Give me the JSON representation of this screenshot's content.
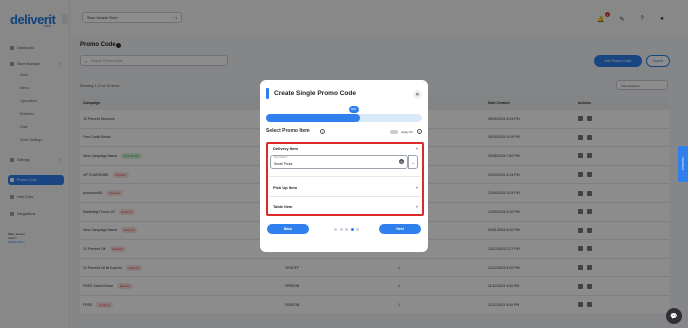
{
  "app": {
    "logo": "deliverit",
    "logo_sub": "WEB"
  },
  "sidebar": {
    "items": [
      {
        "label": "Dashboard"
      },
      {
        "label": "Store Manager"
      },
      {
        "label": "Settings"
      },
      {
        "label": "Promo Code"
      },
      {
        "label": "Help Docs"
      },
      {
        "label": "Integrations"
      }
    ],
    "sub_items": [
      "Store",
      "Menu",
      "Operations",
      "Enablers",
      "Gate",
      "Store Settings"
    ],
    "user": {
      "name": "Mike Jensen",
      "role": "Admin",
      "link": "Switch Store"
    }
  },
  "topbar": {
    "store_select": "Store Sample Store",
    "notification_count": "2"
  },
  "main": {
    "title": "Promo Code",
    "search_placeholder": "Search Promo Code",
    "add_button": "Add Promo Code",
    "export_button": "Export",
    "showing": "Showing 1-10 of 10 items",
    "filter": "View All Items",
    "columns": [
      "Campaign",
      "Code",
      "Usage Count",
      "Date Created",
      "Actions"
    ],
    "rows": [
      {
        "name": "15 Percent Discount",
        "pill": "",
        "code": "",
        "count": "",
        "date": "26/09/2024 4:03 PM"
      },
      {
        "name": "Free Garlic Bread",
        "pill": "",
        "code": "",
        "count": "",
        "date": "26/09/2024 4:03 PM"
      },
      {
        "name": "New Campaign Name",
        "pill": "First Order",
        "pill_type": "first",
        "code": "",
        "count": "",
        "date": "29/08/2024 7:50 PM"
      },
      {
        "name": "UP CHARDNNE",
        "pill": "Expired",
        "pill_type": "exp",
        "code": "",
        "count": "",
        "date": "23/04/2024 4:24 PM"
      },
      {
        "name": "promotion50",
        "pill": "Expired",
        "pill_type": "exp",
        "code": "",
        "count": "",
        "date": "23/04/2024 3:24 PM"
      },
      {
        "name": "Marketing Promo 20",
        "pill": "Expired",
        "pill_type": "exp",
        "code": "",
        "count": "",
        "date": "12/03/2024 4:00 PM"
      },
      {
        "name": "New Campaign Name",
        "pill": "Expired",
        "pill_type": "exp",
        "code": "",
        "count": "",
        "date": "03/01/2024 4:00 PM"
      },
      {
        "name": "10 Percent Off",
        "pill": "Expired",
        "pill_type": "exp",
        "code": "TEN2OFF",
        "count": "1",
        "date": "13/12/2023 2:27 PM"
      },
      {
        "name": "10 Percent off all Experts",
        "pill": "Expired",
        "pill_type": "exp",
        "code": "TENOFF",
        "count": "1",
        "date": "12/12/2023 4:00 PM"
      },
      {
        "name": "FREE Garlic Bread",
        "pill": "Expired",
        "pill_type": "exp",
        "code": "FREEGB",
        "count": "1",
        "date": "11/12/2023 4:00 PM"
      },
      {
        "name": "FREE",
        "pill": "Expired",
        "pill_type": "exp",
        "code": "FREEGB",
        "count": "1",
        "date": "11/12/2023 4:00 PM"
      }
    ]
  },
  "modal": {
    "title": "Create Single Promo Code",
    "progress_percent": 60,
    "progress_label": "60%",
    "select_label": "Select Promo Item",
    "apply_all_label": "Apply All",
    "sections": [
      {
        "title": "Delivery Item",
        "expanded": true,
        "field_label": "Item Name *",
        "field_value": "Small Pizza"
      },
      {
        "title": "Pick Up Item",
        "expanded": false
      },
      {
        "title": "Table Item",
        "expanded": false
      }
    ],
    "back_button": "Back",
    "next_button": "Next",
    "step_count": 5,
    "current_step": 4
  },
  "feedback_tab": "Feedback",
  "colors": {
    "accent": "#2f80ed",
    "highlight": "#d92b2b",
    "expired": "#d93c3c",
    "first_order": "#23a04a"
  }
}
